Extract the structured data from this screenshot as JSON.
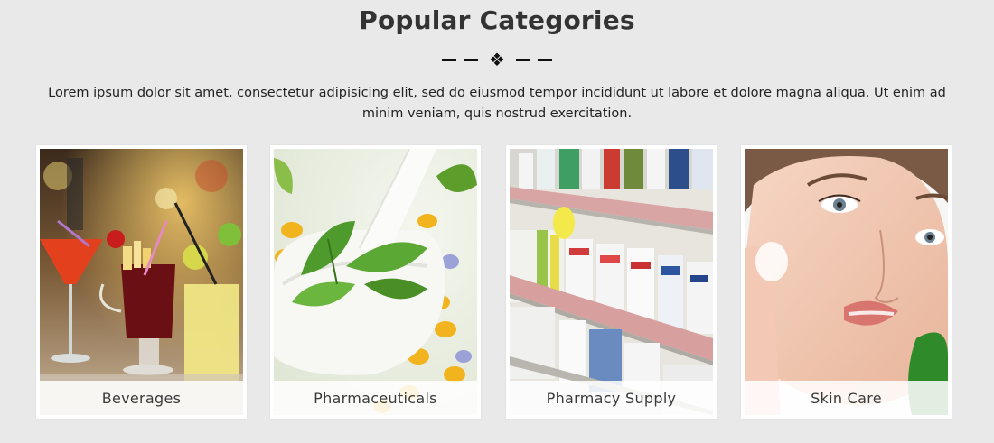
{
  "section": {
    "title": "Popular Categories",
    "divider_glyph": "❖",
    "intro": "Lorem ipsum dolor sit amet, consectetur adipisicing elit, sed do eiusmod tempor incididunt ut labore et dolore magna aliqua. Ut enim ad minim veniam, quis nostrud exercitation."
  },
  "categories": [
    {
      "label": "Beverages",
      "image": "cocktail-drinks-photo"
    },
    {
      "label": "Pharmaceuticals",
      "image": "mortar-pestle-herbs-photo"
    },
    {
      "label": "Pharmacy Supply",
      "image": "pharmacy-shelves-photo"
    },
    {
      "label": "Skin Care",
      "image": "woman-face-cream-photo"
    }
  ]
}
